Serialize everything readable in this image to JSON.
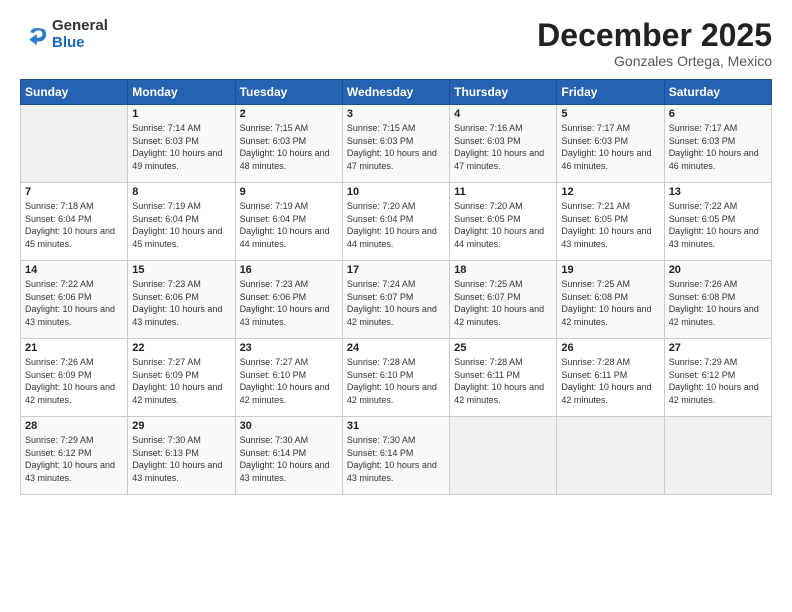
{
  "logo": {
    "general": "General",
    "blue": "Blue"
  },
  "title": "December 2025",
  "location": "Gonzales Ortega, Mexico",
  "headers": [
    "Sunday",
    "Monday",
    "Tuesday",
    "Wednesday",
    "Thursday",
    "Friday",
    "Saturday"
  ],
  "weeks": [
    [
      {
        "num": "",
        "sunrise": "",
        "sunset": "",
        "daylight": ""
      },
      {
        "num": "1",
        "sunrise": "Sunrise: 7:14 AM",
        "sunset": "Sunset: 6:03 PM",
        "daylight": "Daylight: 10 hours and 49 minutes."
      },
      {
        "num": "2",
        "sunrise": "Sunrise: 7:15 AM",
        "sunset": "Sunset: 6:03 PM",
        "daylight": "Daylight: 10 hours and 48 minutes."
      },
      {
        "num": "3",
        "sunrise": "Sunrise: 7:15 AM",
        "sunset": "Sunset: 6:03 PM",
        "daylight": "Daylight: 10 hours and 47 minutes."
      },
      {
        "num": "4",
        "sunrise": "Sunrise: 7:16 AM",
        "sunset": "Sunset: 6:03 PM",
        "daylight": "Daylight: 10 hours and 47 minutes."
      },
      {
        "num": "5",
        "sunrise": "Sunrise: 7:17 AM",
        "sunset": "Sunset: 6:03 PM",
        "daylight": "Daylight: 10 hours and 46 minutes."
      },
      {
        "num": "6",
        "sunrise": "Sunrise: 7:17 AM",
        "sunset": "Sunset: 6:03 PM",
        "daylight": "Daylight: 10 hours and 46 minutes."
      }
    ],
    [
      {
        "num": "7",
        "sunrise": "Sunrise: 7:18 AM",
        "sunset": "Sunset: 6:04 PM",
        "daylight": "Daylight: 10 hours and 45 minutes."
      },
      {
        "num": "8",
        "sunrise": "Sunrise: 7:19 AM",
        "sunset": "Sunset: 6:04 PM",
        "daylight": "Daylight: 10 hours and 45 minutes."
      },
      {
        "num": "9",
        "sunrise": "Sunrise: 7:19 AM",
        "sunset": "Sunset: 6:04 PM",
        "daylight": "Daylight: 10 hours and 44 minutes."
      },
      {
        "num": "10",
        "sunrise": "Sunrise: 7:20 AM",
        "sunset": "Sunset: 6:04 PM",
        "daylight": "Daylight: 10 hours and 44 minutes."
      },
      {
        "num": "11",
        "sunrise": "Sunrise: 7:20 AM",
        "sunset": "Sunset: 6:05 PM",
        "daylight": "Daylight: 10 hours and 44 minutes."
      },
      {
        "num": "12",
        "sunrise": "Sunrise: 7:21 AM",
        "sunset": "Sunset: 6:05 PM",
        "daylight": "Daylight: 10 hours and 43 minutes."
      },
      {
        "num": "13",
        "sunrise": "Sunrise: 7:22 AM",
        "sunset": "Sunset: 6:05 PM",
        "daylight": "Daylight: 10 hours and 43 minutes."
      }
    ],
    [
      {
        "num": "14",
        "sunrise": "Sunrise: 7:22 AM",
        "sunset": "Sunset: 6:06 PM",
        "daylight": "Daylight: 10 hours and 43 minutes."
      },
      {
        "num": "15",
        "sunrise": "Sunrise: 7:23 AM",
        "sunset": "Sunset: 6:06 PM",
        "daylight": "Daylight: 10 hours and 43 minutes."
      },
      {
        "num": "16",
        "sunrise": "Sunrise: 7:23 AM",
        "sunset": "Sunset: 6:06 PM",
        "daylight": "Daylight: 10 hours and 43 minutes."
      },
      {
        "num": "17",
        "sunrise": "Sunrise: 7:24 AM",
        "sunset": "Sunset: 6:07 PM",
        "daylight": "Daylight: 10 hours and 42 minutes."
      },
      {
        "num": "18",
        "sunrise": "Sunrise: 7:25 AM",
        "sunset": "Sunset: 6:07 PM",
        "daylight": "Daylight: 10 hours and 42 minutes."
      },
      {
        "num": "19",
        "sunrise": "Sunrise: 7:25 AM",
        "sunset": "Sunset: 6:08 PM",
        "daylight": "Daylight: 10 hours and 42 minutes."
      },
      {
        "num": "20",
        "sunrise": "Sunrise: 7:26 AM",
        "sunset": "Sunset: 6:08 PM",
        "daylight": "Daylight: 10 hours and 42 minutes."
      }
    ],
    [
      {
        "num": "21",
        "sunrise": "Sunrise: 7:26 AM",
        "sunset": "Sunset: 6:09 PM",
        "daylight": "Daylight: 10 hours and 42 minutes."
      },
      {
        "num": "22",
        "sunrise": "Sunrise: 7:27 AM",
        "sunset": "Sunset: 6:09 PM",
        "daylight": "Daylight: 10 hours and 42 minutes."
      },
      {
        "num": "23",
        "sunrise": "Sunrise: 7:27 AM",
        "sunset": "Sunset: 6:10 PM",
        "daylight": "Daylight: 10 hours and 42 minutes."
      },
      {
        "num": "24",
        "sunrise": "Sunrise: 7:28 AM",
        "sunset": "Sunset: 6:10 PM",
        "daylight": "Daylight: 10 hours and 42 minutes."
      },
      {
        "num": "25",
        "sunrise": "Sunrise: 7:28 AM",
        "sunset": "Sunset: 6:11 PM",
        "daylight": "Daylight: 10 hours and 42 minutes."
      },
      {
        "num": "26",
        "sunrise": "Sunrise: 7:28 AM",
        "sunset": "Sunset: 6:11 PM",
        "daylight": "Daylight: 10 hours and 42 minutes."
      },
      {
        "num": "27",
        "sunrise": "Sunrise: 7:29 AM",
        "sunset": "Sunset: 6:12 PM",
        "daylight": "Daylight: 10 hours and 42 minutes."
      }
    ],
    [
      {
        "num": "28",
        "sunrise": "Sunrise: 7:29 AM",
        "sunset": "Sunset: 6:12 PM",
        "daylight": "Daylight: 10 hours and 43 minutes."
      },
      {
        "num": "29",
        "sunrise": "Sunrise: 7:30 AM",
        "sunset": "Sunset: 6:13 PM",
        "daylight": "Daylight: 10 hours and 43 minutes."
      },
      {
        "num": "30",
        "sunrise": "Sunrise: 7:30 AM",
        "sunset": "Sunset: 6:14 PM",
        "daylight": "Daylight: 10 hours and 43 minutes."
      },
      {
        "num": "31",
        "sunrise": "Sunrise: 7:30 AM",
        "sunset": "Sunset: 6:14 PM",
        "daylight": "Daylight: 10 hours and 43 minutes."
      },
      {
        "num": "",
        "sunrise": "",
        "sunset": "",
        "daylight": ""
      },
      {
        "num": "",
        "sunrise": "",
        "sunset": "",
        "daylight": ""
      },
      {
        "num": "",
        "sunrise": "",
        "sunset": "",
        "daylight": ""
      }
    ]
  ]
}
